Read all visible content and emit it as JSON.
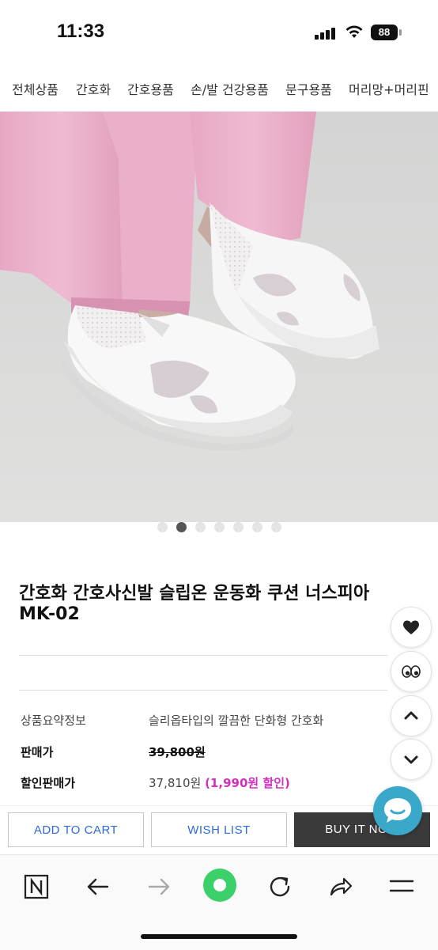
{
  "status": {
    "time": "11:33",
    "battery": "88"
  },
  "categories": [
    "전체상품",
    "간호화",
    "간호용품",
    "손/발 건강용품",
    "문구용품",
    "머리망+머리핀"
  ],
  "carousel": {
    "count": 7,
    "active_index": 1
  },
  "product": {
    "title": "간호화 간호사신발 슬립온 운동화 쿠션 너스피아 MK-02"
  },
  "info": {
    "summary_label": "상품요약정보",
    "summary_value": "슬리옵타입의 깔끔한 단화형 간호화",
    "price_label": "판매가",
    "price_value": "39,800원",
    "sale_label": "할인판매가",
    "sale_value": "37,810원",
    "discount_text": "(1,990원 할인)"
  },
  "actions": {
    "cart": "ADD TO CART",
    "wish": "WISH LIST",
    "buy": "BUY IT NOW"
  },
  "side_buttons": [
    "heart-icon",
    "eyes-icon",
    "chevron-up-icon",
    "chevron-down-icon"
  ],
  "colors": {
    "accent_blue": "#2b6bd6",
    "discount_pink": "#d22fbf",
    "chat": "#3aa8c8",
    "browser_green": "#3cd06a"
  }
}
